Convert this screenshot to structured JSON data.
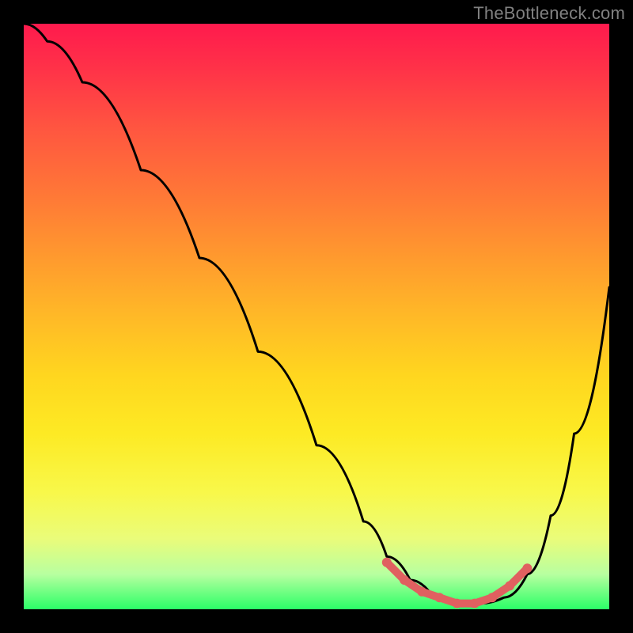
{
  "watermark": "TheBottleneck.com",
  "chart_data": {
    "type": "line",
    "title": "",
    "xlabel": "",
    "ylabel": "",
    "xlim": [
      0,
      100
    ],
    "ylim": [
      0,
      100
    ],
    "grid": false,
    "series": [
      {
        "name": "curve",
        "color": "#000000",
        "x": [
          0,
          4,
          10,
          20,
          30,
          40,
          50,
          58,
          62,
          66,
          70,
          74,
          78,
          82,
          86,
          90,
          94,
          100
        ],
        "y": [
          100,
          97,
          90,
          75,
          60,
          44,
          28,
          15,
          9,
          5,
          2,
          1,
          1,
          2,
          6,
          16,
          30,
          55
        ]
      },
      {
        "name": "bottleneck-marker",
        "color": "#e06060",
        "type": "scatter",
        "x": [
          62,
          65,
          68,
          71,
          74,
          77,
          80,
          83,
          86
        ],
        "y": [
          8,
          5,
          3,
          2,
          1,
          1,
          2,
          4,
          7
        ]
      }
    ],
    "background_gradient": {
      "top": "#ff1a4d",
      "mid": "#ffd61f",
      "bottom": "#2bff67"
    }
  }
}
